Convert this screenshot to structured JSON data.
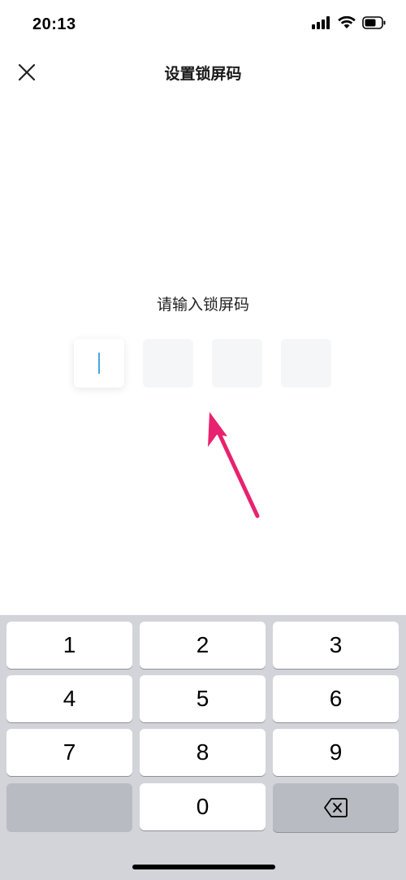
{
  "status_bar": {
    "time": "20:13",
    "icons": [
      "cellular-signal-icon",
      "wifi-icon",
      "battery-icon"
    ]
  },
  "header": {
    "title": "设置锁屏码",
    "close_icon": "close-icon"
  },
  "prompt": "请输入锁屏码",
  "code_boxes": [
    "",
    "",
    "",
    ""
  ],
  "keypad": {
    "keys": [
      "1",
      "2",
      "3",
      "4",
      "5",
      "6",
      "7",
      "8",
      "9",
      "0"
    ],
    "delete_icon": "backspace-icon"
  },
  "colors": {
    "caret": "#4aa6e0",
    "annotation_arrow": "#e8226e",
    "keypad_background": "#d2d4d9"
  }
}
